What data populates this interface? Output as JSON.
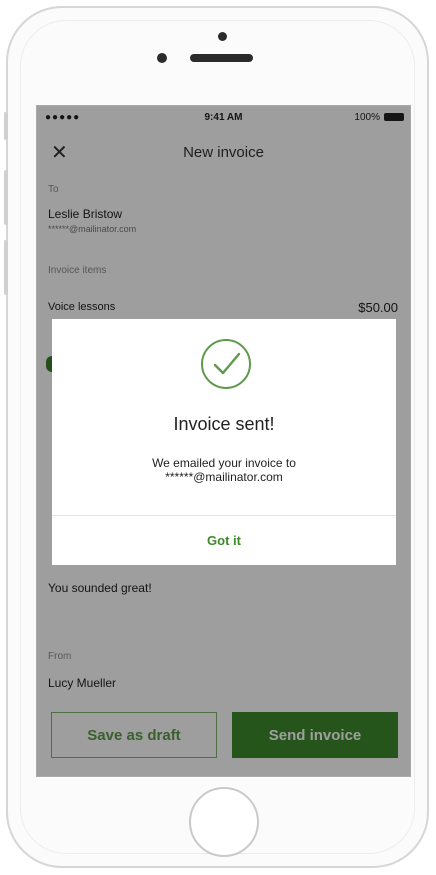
{
  "status_bar": {
    "carrier": "●●●●● ",
    "time": "9:41 AM",
    "battery": "100%"
  },
  "nav": {
    "title": "New invoice"
  },
  "form": {
    "to_label": "To",
    "customer_name": "Leslie Bristow",
    "customer_email": "******@mailinator.com",
    "items_label": "Invoice items",
    "item_name": "Voice lessons",
    "item_amount": "$50.00",
    "message_value": "You sounded great!",
    "from_label": "From",
    "from_value": "Lucy Mueller"
  },
  "buttons": {
    "save_draft": "Save as draft",
    "send_invoice": "Send invoice"
  },
  "dialog": {
    "title": "Invoice sent!",
    "message_line1": "We emailed your invoice to",
    "message_line2": "******@mailinator.com",
    "confirm": "Got it"
  },
  "colors": {
    "brand_green": "#3d8a2a",
    "overlay": "rgba(0,0,0,0.38)"
  },
  "icons": {
    "close": "close-icon",
    "success": "check-circle-icon"
  }
}
